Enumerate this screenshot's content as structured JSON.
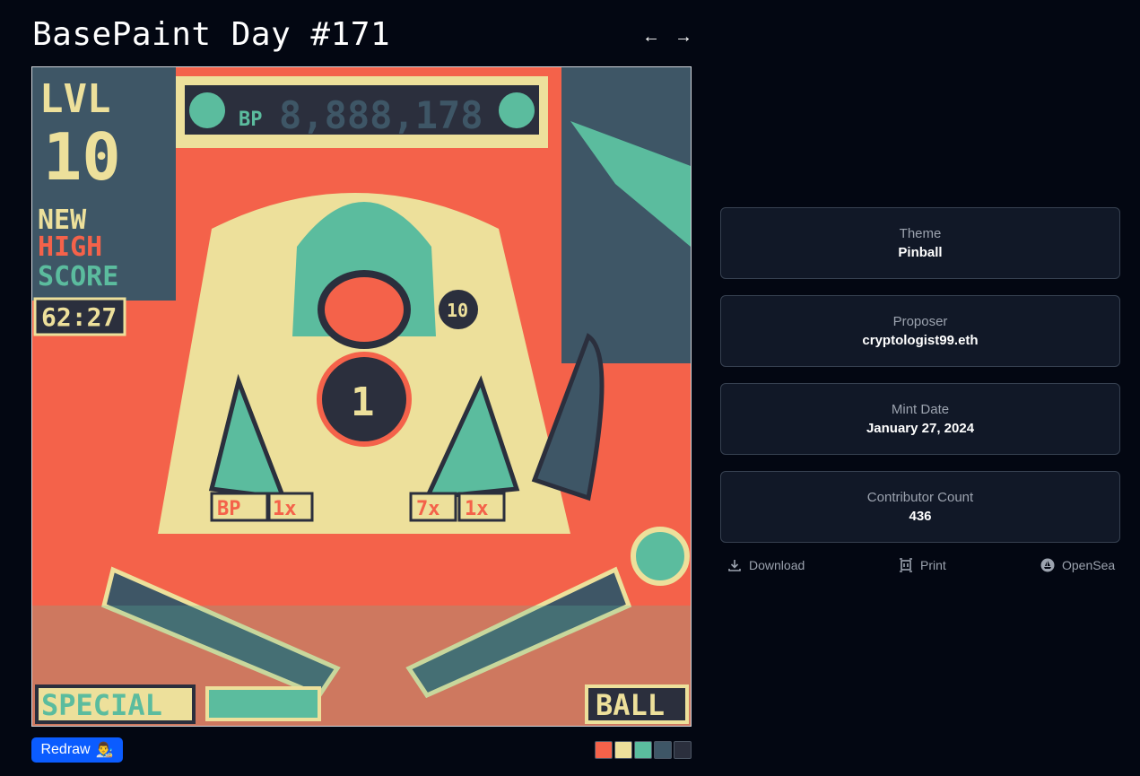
{
  "header": {
    "title": "BasePaint Day #171",
    "prev_icon": "arrow-left-icon",
    "next_icon": "arrow-right-icon",
    "prev": "←",
    "next": "→"
  },
  "artwork": {
    "palette": [
      "#f4624a",
      "#ede09b",
      "#5bbc9e",
      "#3e5666",
      "#2b2f3d"
    ],
    "texts": {
      "lvl": "LVL",
      "level": "10",
      "new": "NEW",
      "high": "HIGH",
      "score": "SCORE",
      "time": "62:27",
      "counter": "8,888,178",
      "bp": "BP",
      "mult1": "1x",
      "mult7": "7x",
      "mult1b": "1x",
      "special": "SPECIAL",
      "ball": "BALL",
      "badge10": "10",
      "center": "1"
    }
  },
  "redraw": {
    "label": "Redraw",
    "emoji": "👨‍🎨"
  },
  "details": [
    {
      "label": "Theme",
      "value": "Pinball"
    },
    {
      "label": "Proposer",
      "value": "cryptologist99.eth"
    },
    {
      "label": "Mint Date",
      "value": "January 27, 2024"
    },
    {
      "label": "Contributor Count",
      "value": "436"
    }
  ],
  "actions": [
    {
      "label": "Download",
      "icon": "download-icon"
    },
    {
      "label": "Print",
      "icon": "print-frame-icon"
    },
    {
      "label": "OpenSea",
      "icon": "opensea-icon"
    }
  ]
}
